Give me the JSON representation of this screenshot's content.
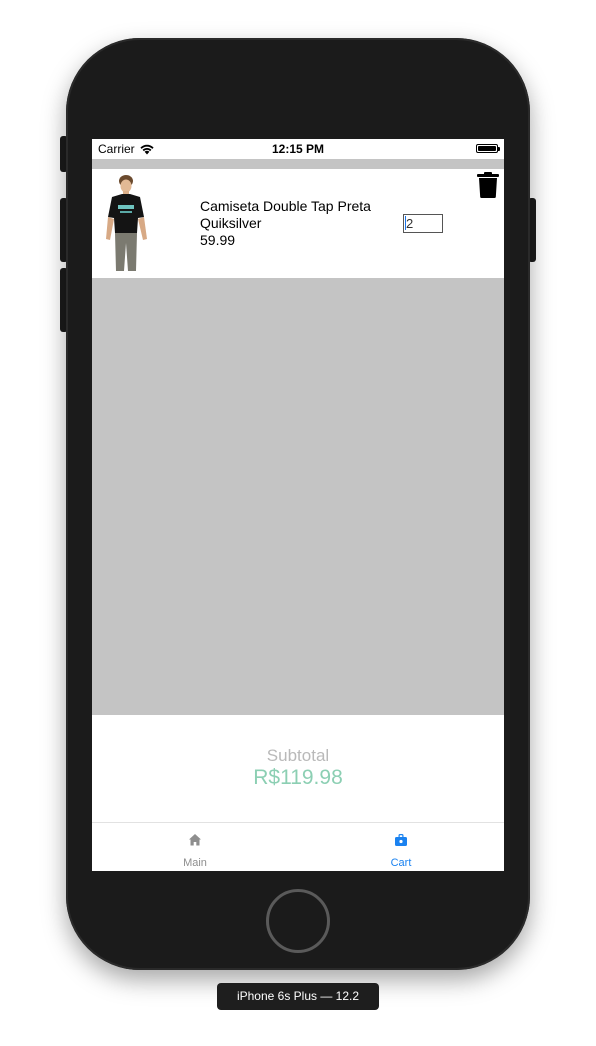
{
  "status_bar": {
    "carrier": "Carrier",
    "time": "12:15 PM"
  },
  "cart": {
    "items": [
      {
        "name_line1": "Camiseta Double Tap Preta",
        "name_line2": "Quiksilver",
        "price": "59.99",
        "quantity": "2",
        "image_icon": "tshirt-model-photo"
      }
    ]
  },
  "subtotal": {
    "label": "Subtotal",
    "value": "R$119.98"
  },
  "tabs": [
    {
      "label": "Main",
      "icon": "home-icon",
      "active": false
    },
    {
      "label": "Cart",
      "icon": "shopping-bag-icon",
      "active": true
    }
  ],
  "device_caption": "iPhone 6s Plus — 12.2",
  "colors": {
    "subtotal_value": "#8ccfb3",
    "subtotal_label": "#b9b9b9",
    "active_tab": "#1a82f0",
    "inactive_tab": "#8e8e8e",
    "list_background": "#c4c4c4"
  }
}
